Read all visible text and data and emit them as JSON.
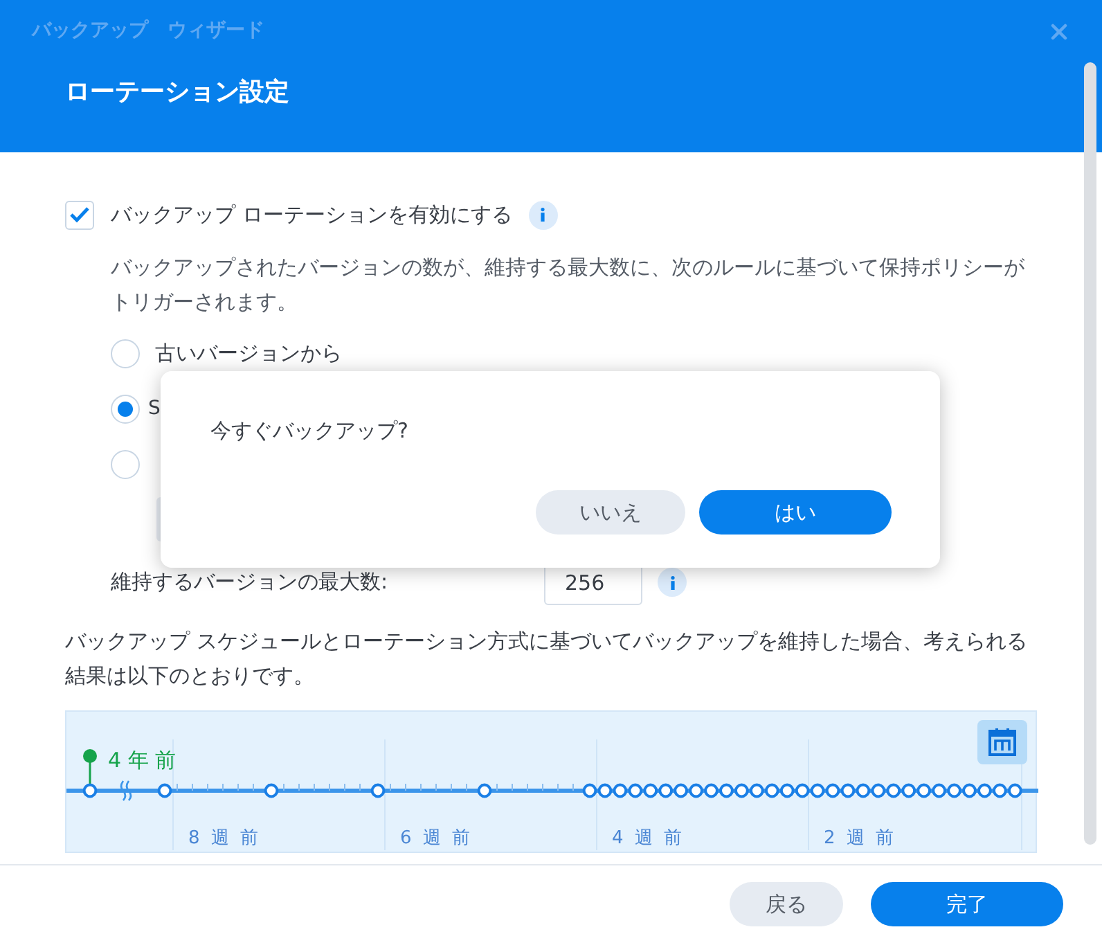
{
  "window": {
    "title": "バックアップ　ウィザード"
  },
  "page_title": "ローテーション設定",
  "enable_rotation": {
    "label": "バックアップ ローテーションを有効にする",
    "checked": true
  },
  "description": "バックアップされたバージョンの数が、維持する最大数に、次のルールに基づいて保持ポリシーがトリガーされます。",
  "rotation_options": [
    {
      "label": "古いバージョンから",
      "selected": false
    },
    {
      "label": "S",
      "selected": true
    },
    {
      "selected": false
    }
  ],
  "max_versions": {
    "label": "維持するバージョンの最大数:",
    "value": "256"
  },
  "result_text": "バックアップ スケジュールとローテーション方式に基づいてバックアップを維持した場合、考えられる結果は以下のとおりです。",
  "timeline": {
    "oldest": "4 年 前",
    "labels": [
      "8 週 前",
      "6 週 前",
      "4 週 前",
      "2 週 前"
    ]
  },
  "dialog": {
    "message": "今すぐバックアップ?",
    "buttons": [
      {
        "label": "いいえ",
        "kind": "secondary"
      },
      {
        "label": "はい",
        "kind": "primary"
      }
    ]
  },
  "footer_buttons": [
    {
      "label": "戻る",
      "kind": "secondary"
    },
    {
      "label": "完了",
      "kind": "primary"
    }
  ]
}
